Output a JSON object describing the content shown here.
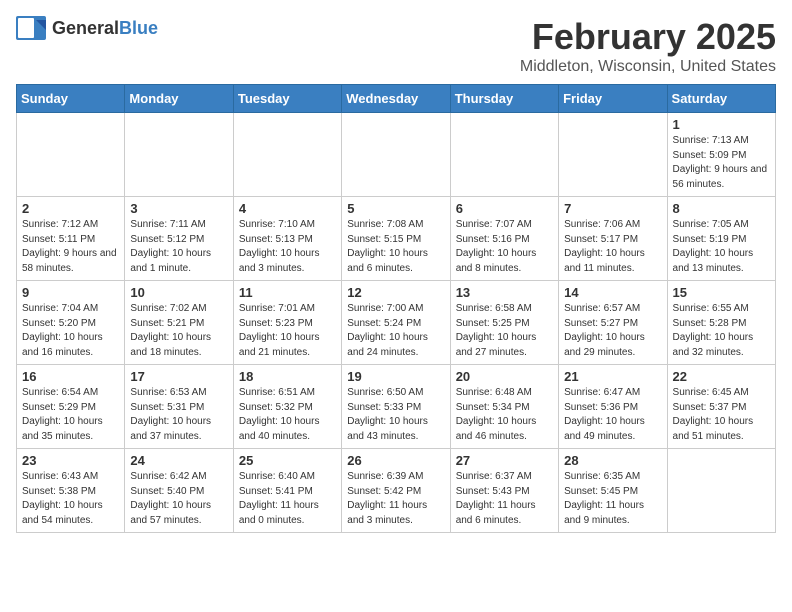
{
  "header": {
    "logo_general": "General",
    "logo_blue": "Blue",
    "month_title": "February 2025",
    "location": "Middleton, Wisconsin, United States"
  },
  "days_of_week": [
    "Sunday",
    "Monday",
    "Tuesday",
    "Wednesday",
    "Thursday",
    "Friday",
    "Saturday"
  ],
  "weeks": [
    [
      {
        "day": "",
        "info": ""
      },
      {
        "day": "",
        "info": ""
      },
      {
        "day": "",
        "info": ""
      },
      {
        "day": "",
        "info": ""
      },
      {
        "day": "",
        "info": ""
      },
      {
        "day": "",
        "info": ""
      },
      {
        "day": "1",
        "info": "Sunrise: 7:13 AM\nSunset: 5:09 PM\nDaylight: 9 hours and 56 minutes."
      }
    ],
    [
      {
        "day": "2",
        "info": "Sunrise: 7:12 AM\nSunset: 5:11 PM\nDaylight: 9 hours and 58 minutes."
      },
      {
        "day": "3",
        "info": "Sunrise: 7:11 AM\nSunset: 5:12 PM\nDaylight: 10 hours and 1 minute."
      },
      {
        "day": "4",
        "info": "Sunrise: 7:10 AM\nSunset: 5:13 PM\nDaylight: 10 hours and 3 minutes."
      },
      {
        "day": "5",
        "info": "Sunrise: 7:08 AM\nSunset: 5:15 PM\nDaylight: 10 hours and 6 minutes."
      },
      {
        "day": "6",
        "info": "Sunrise: 7:07 AM\nSunset: 5:16 PM\nDaylight: 10 hours and 8 minutes."
      },
      {
        "day": "7",
        "info": "Sunrise: 7:06 AM\nSunset: 5:17 PM\nDaylight: 10 hours and 11 minutes."
      },
      {
        "day": "8",
        "info": "Sunrise: 7:05 AM\nSunset: 5:19 PM\nDaylight: 10 hours and 13 minutes."
      }
    ],
    [
      {
        "day": "9",
        "info": "Sunrise: 7:04 AM\nSunset: 5:20 PM\nDaylight: 10 hours and 16 minutes."
      },
      {
        "day": "10",
        "info": "Sunrise: 7:02 AM\nSunset: 5:21 PM\nDaylight: 10 hours and 18 minutes."
      },
      {
        "day": "11",
        "info": "Sunrise: 7:01 AM\nSunset: 5:23 PM\nDaylight: 10 hours and 21 minutes."
      },
      {
        "day": "12",
        "info": "Sunrise: 7:00 AM\nSunset: 5:24 PM\nDaylight: 10 hours and 24 minutes."
      },
      {
        "day": "13",
        "info": "Sunrise: 6:58 AM\nSunset: 5:25 PM\nDaylight: 10 hours and 27 minutes."
      },
      {
        "day": "14",
        "info": "Sunrise: 6:57 AM\nSunset: 5:27 PM\nDaylight: 10 hours and 29 minutes."
      },
      {
        "day": "15",
        "info": "Sunrise: 6:55 AM\nSunset: 5:28 PM\nDaylight: 10 hours and 32 minutes."
      }
    ],
    [
      {
        "day": "16",
        "info": "Sunrise: 6:54 AM\nSunset: 5:29 PM\nDaylight: 10 hours and 35 minutes."
      },
      {
        "day": "17",
        "info": "Sunrise: 6:53 AM\nSunset: 5:31 PM\nDaylight: 10 hours and 37 minutes."
      },
      {
        "day": "18",
        "info": "Sunrise: 6:51 AM\nSunset: 5:32 PM\nDaylight: 10 hours and 40 minutes."
      },
      {
        "day": "19",
        "info": "Sunrise: 6:50 AM\nSunset: 5:33 PM\nDaylight: 10 hours and 43 minutes."
      },
      {
        "day": "20",
        "info": "Sunrise: 6:48 AM\nSunset: 5:34 PM\nDaylight: 10 hours and 46 minutes."
      },
      {
        "day": "21",
        "info": "Sunrise: 6:47 AM\nSunset: 5:36 PM\nDaylight: 10 hours and 49 minutes."
      },
      {
        "day": "22",
        "info": "Sunrise: 6:45 AM\nSunset: 5:37 PM\nDaylight: 10 hours and 51 minutes."
      }
    ],
    [
      {
        "day": "23",
        "info": "Sunrise: 6:43 AM\nSunset: 5:38 PM\nDaylight: 10 hours and 54 minutes."
      },
      {
        "day": "24",
        "info": "Sunrise: 6:42 AM\nSunset: 5:40 PM\nDaylight: 10 hours and 57 minutes."
      },
      {
        "day": "25",
        "info": "Sunrise: 6:40 AM\nSunset: 5:41 PM\nDaylight: 11 hours and 0 minutes."
      },
      {
        "day": "26",
        "info": "Sunrise: 6:39 AM\nSunset: 5:42 PM\nDaylight: 11 hours and 3 minutes."
      },
      {
        "day": "27",
        "info": "Sunrise: 6:37 AM\nSunset: 5:43 PM\nDaylight: 11 hours and 6 minutes."
      },
      {
        "day": "28",
        "info": "Sunrise: 6:35 AM\nSunset: 5:45 PM\nDaylight: 11 hours and 9 minutes."
      },
      {
        "day": "",
        "info": ""
      }
    ]
  ]
}
